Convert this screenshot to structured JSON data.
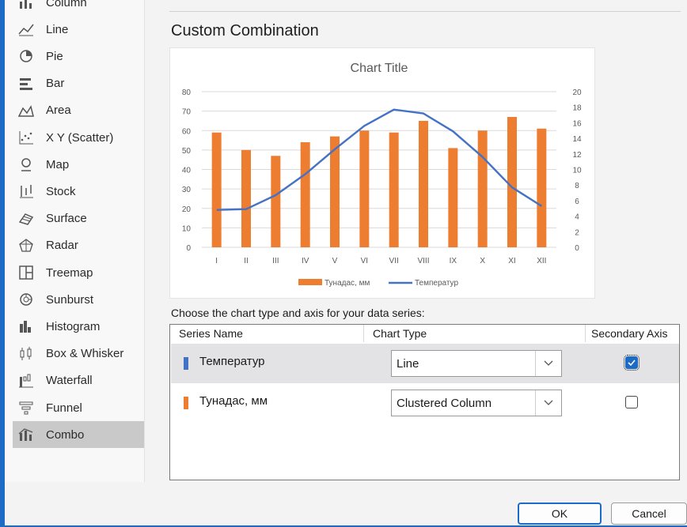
{
  "sidebar": {
    "items": [
      {
        "label": "Column",
        "icon": "column-chart-icon"
      },
      {
        "label": "Line",
        "icon": "line-chart-icon"
      },
      {
        "label": "Pie",
        "icon": "pie-chart-icon"
      },
      {
        "label": "Bar",
        "icon": "bar-chart-icon"
      },
      {
        "label": "Area",
        "icon": "area-chart-icon"
      },
      {
        "label": "X Y (Scatter)",
        "icon": "scatter-chart-icon"
      },
      {
        "label": "Map",
        "icon": "map-chart-icon"
      },
      {
        "label": "Stock",
        "icon": "stock-chart-icon"
      },
      {
        "label": "Surface",
        "icon": "surface-chart-icon"
      },
      {
        "label": "Radar",
        "icon": "radar-chart-icon"
      },
      {
        "label": "Treemap",
        "icon": "treemap-chart-icon"
      },
      {
        "label": "Sunburst",
        "icon": "sunburst-chart-icon"
      },
      {
        "label": "Histogram",
        "icon": "histogram-chart-icon"
      },
      {
        "label": "Box & Whisker",
        "icon": "box-whisker-chart-icon"
      },
      {
        "label": "Waterfall",
        "icon": "waterfall-chart-icon"
      },
      {
        "label": "Funnel",
        "icon": "funnel-chart-icon"
      },
      {
        "label": "Combo",
        "icon": "combo-chart-icon",
        "selected": true
      }
    ]
  },
  "main": {
    "heading": "Custom Combination",
    "series_prompt": "Choose the chart type and axis for your data series:",
    "table": {
      "headers": {
        "series_name": "Series Name",
        "chart_type": "Chart Type",
        "secondary_axis": "Secondary Axis"
      },
      "rows": [
        {
          "name": "Температур",
          "type": "Line",
          "secondary": true,
          "color": "#4472c4"
        },
        {
          "name": "Тунадас, мм",
          "type": "Clustered Column",
          "secondary": false,
          "color": "#ed7d31"
        }
      ]
    }
  },
  "buttons": {
    "ok": "OK",
    "cancel": "Cancel"
  },
  "colors": {
    "accent": "#1d6bc4",
    "column_series": "#ed7d31",
    "line_series": "#4472c4"
  },
  "chart_data": {
    "type": "bar",
    "title": "Chart Title",
    "categories": [
      "I",
      "II",
      "III",
      "IV",
      "V",
      "VI",
      "VII",
      "VIII",
      "IX",
      "X",
      "XI",
      "XII"
    ],
    "series": [
      {
        "name": "Тунадас, мм",
        "type": "bar",
        "axis": "primary",
        "values": [
          59,
          50,
          47,
          54,
          57,
          60,
          59,
          65,
          51,
          60,
          67,
          61
        ]
      },
      {
        "name": "Температур",
        "type": "line",
        "axis": "secondary",
        "values": [
          4.8,
          4.9,
          6.7,
          9.4,
          12.6,
          15.6,
          17.7,
          17.2,
          14.9,
          11.6,
          7.7,
          5.3
        ]
      }
    ],
    "ylim": [
      0,
      80
    ],
    "y_ticks": [
      "0",
      "10",
      "20",
      "30",
      "40",
      "50",
      "60",
      "70",
      "80"
    ],
    "y2lim": [
      0,
      20
    ],
    "y2_ticks": [
      "0",
      "2",
      "4",
      "6",
      "8",
      "10",
      "12",
      "14",
      "16",
      "18",
      "20"
    ],
    "grid": true,
    "legend": "bottom"
  }
}
